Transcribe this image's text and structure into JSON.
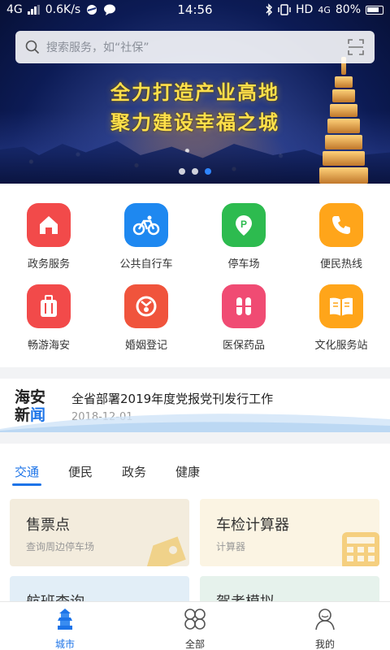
{
  "status_bar": {
    "network": "4G",
    "speed": "0.6K/s",
    "time": "14:56",
    "right_text": "HD",
    "right_net": "4G",
    "battery": "80%"
  },
  "search": {
    "placeholder": "搜索服务，如“社保”"
  },
  "banner": {
    "line1": "全力打造产业高地",
    "line2": "聚力建设幸福之城",
    "active_slide": 2,
    "slide_count": 3
  },
  "services": [
    {
      "label": "政务服务",
      "icon": "home-icon",
      "color": "#f24a4a"
    },
    {
      "label": "公共自行车",
      "icon": "bicycle-icon",
      "color": "#1e88f0"
    },
    {
      "label": "停车场",
      "icon": "parking-icon",
      "color": "#2dbb4f"
    },
    {
      "label": "便民热线",
      "icon": "phone-icon",
      "color": "#ffa51a"
    },
    {
      "label": "畅游海安",
      "icon": "luggage-icon",
      "color": "#f24a4a"
    },
    {
      "label": "婚姻登记",
      "icon": "marriage-icon",
      "color": "#f0543c"
    },
    {
      "label": "医保药品",
      "icon": "pill-icon",
      "color": "#f04b73"
    },
    {
      "label": "文化服务站",
      "icon": "book-icon",
      "color": "#ffa51a"
    }
  ],
  "news": {
    "logo_line1": "海安",
    "logo_line2a": "新",
    "logo_line2b": "闻",
    "title": "全省部署2019年度党报党刊发行工作",
    "date": "2018-12-01"
  },
  "tabs": [
    "交通",
    "便民",
    "政务",
    "健康"
  ],
  "active_tab": 0,
  "cards": [
    {
      "title": "售票点",
      "subtitle": "查询周边停车场",
      "bg": "#f3ecdd"
    },
    {
      "title": "车检计算器",
      "subtitle": "计算器",
      "bg": "#fbf4e3"
    },
    {
      "title": "航班查询",
      "subtitle": "",
      "bg": "#e2eef7"
    },
    {
      "title": "驾考模拟",
      "subtitle": "",
      "bg": "#e6f2ec"
    }
  ],
  "bottom_nav": [
    {
      "label": "城市",
      "icon": "city-icon"
    },
    {
      "label": "全部",
      "icon": "grid-icon"
    },
    {
      "label": "我的",
      "icon": "user-icon"
    }
  ],
  "colors": {
    "accent": "#1d74e8"
  }
}
